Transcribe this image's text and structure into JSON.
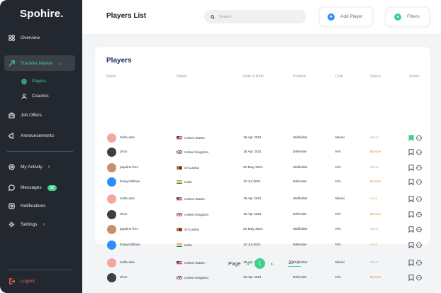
{
  "sidebar": {
    "logo": "Spohire.",
    "overview": "Overview",
    "transfer_market": "Transfer Market",
    "players": "Players",
    "coaches": "Coaches",
    "job_offers": "Job Offers",
    "announcements": "Announcements",
    "my_activity": "My Activity",
    "messages": "Messages",
    "messages_badge": "12",
    "notifications": "Notifications",
    "settings": "Settings",
    "logout": "Logout"
  },
  "header": {
    "title": "Players List",
    "search_placeholder": "Search",
    "add_player": "Add Player",
    "filters": "Filters"
  },
  "table": {
    "title": "Players",
    "columns": [
      "Name",
      "Nation",
      "Date of Birth",
      "Position",
      "Club",
      "Status",
      "Action"
    ],
    "rows": [
      {
        "name": "Sofia asin",
        "nation": "United States",
        "flag": "us",
        "dob": "18 Apr 2021",
        "position": "Midfielder",
        "club": "Miami",
        "status": "Silver",
        "saved": true
      },
      {
        "name": "Jhon",
        "nation": "United Kingdom",
        "flag": "uk",
        "dob": "18 Apr 2021",
        "position": "Defender",
        "club": "N/A",
        "status": "Bronze",
        "saved": false
      },
      {
        "name": "jaquline fren",
        "nation": "Sri Lanka",
        "flag": "lk",
        "dob": "20 May 2021",
        "position": "Midfielder",
        "club": "N/A",
        "status": "Silver",
        "saved": false
      },
      {
        "name": "Dulaj Dilshan",
        "nation": "India",
        "flag": "in",
        "dob": "12 Jul 2021",
        "position": "Defender",
        "club": "N/A",
        "status": "Bronze",
        "saved": false
      },
      {
        "name": "Sofia asin",
        "nation": "United States",
        "flag": "us",
        "dob": "18 Apr 2021",
        "position": "Midfielder",
        "club": "Miami",
        "status": "Gold",
        "saved": false
      },
      {
        "name": "Jhon",
        "nation": "United Kingdom",
        "flag": "uk",
        "dob": "18 Apr 2021",
        "position": "Defender",
        "club": "N/A",
        "status": "Bronze",
        "saved": false
      },
      {
        "name": "jaquline fren",
        "nation": "Sri Lanka",
        "flag": "lk",
        "dob": "20 May 2021",
        "position": "Midfielder",
        "club": "N/A",
        "status": "Silver",
        "saved": false
      },
      {
        "name": "Dulaj Dilshan",
        "nation": "India",
        "flag": "in",
        "dob": "12 Jul 2021",
        "position": "Defender",
        "club": "N/A",
        "status": "Gold",
        "saved": false
      },
      {
        "name": "Sofia asin",
        "nation": "United States",
        "flag": "us",
        "dob": "18 Apr 2021",
        "position": "Midfielder",
        "club": "Miami",
        "status": "Silver",
        "saved": false
      },
      {
        "name": "Jhon",
        "nation": "United Kingdom",
        "flag": "uk",
        "dob": "18 Apr 2021",
        "position": "Defender",
        "club": "N/A",
        "status": "Bronze",
        "saved": false
      }
    ]
  },
  "pagination": {
    "label": "Page",
    "current": "1",
    "per_page": "30"
  },
  "colors": {
    "accent": "#3ed18c",
    "sidebar_bg": "#23272f",
    "status_silver": "#b0b5bd",
    "status_bronze": "#e08a3c",
    "status_gold": "#e8b54a",
    "logout": "#ff6b57"
  }
}
